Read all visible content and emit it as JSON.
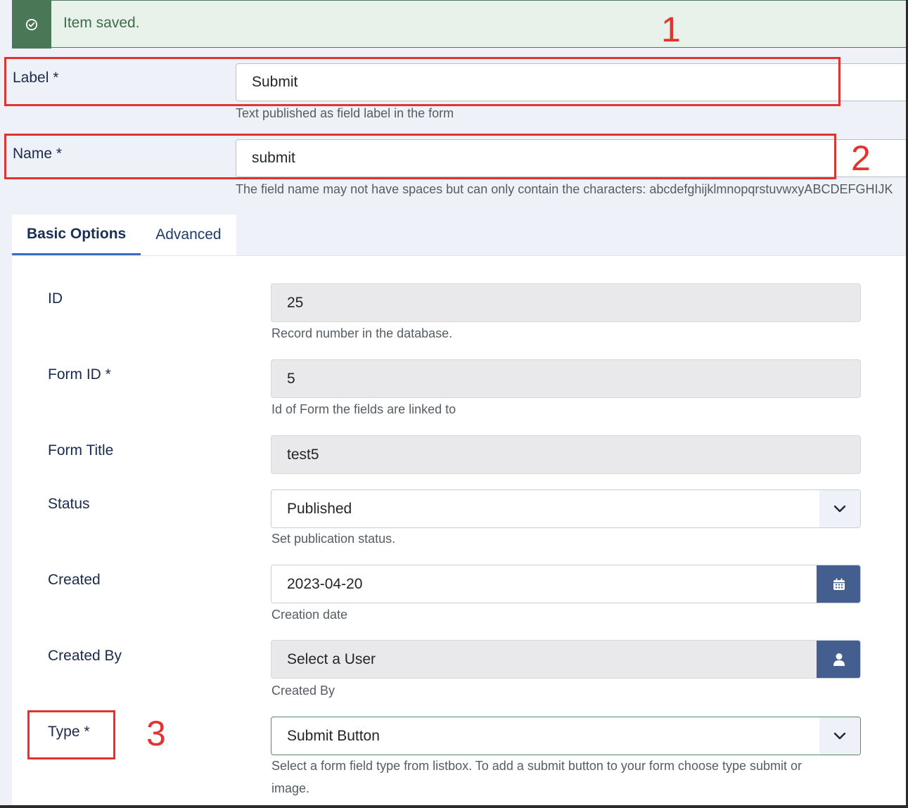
{
  "alert": {
    "message": "Item saved."
  },
  "label_field": {
    "label": "Label *",
    "value": "Submit",
    "hint": "Text published as field label in the form"
  },
  "name_field": {
    "label": "Name *",
    "value": "submit",
    "hint": "The field name may not have spaces but can only contain the characters: abcdefghijklmnopqrstuvwxyABCDEFGHIJK"
  },
  "tabs": [
    {
      "label": "Basic Options"
    },
    {
      "label": "Advanced"
    }
  ],
  "fields": {
    "id": {
      "label": "ID",
      "value": "25",
      "hint": "Record number in the database."
    },
    "form_id": {
      "label": "Form ID *",
      "value": "5",
      "hint": "Id of Form the fields are linked to"
    },
    "form_title": {
      "label": "Form Title",
      "value": "test5"
    },
    "status": {
      "label": "Status",
      "value": "Published",
      "hint": "Set publication status."
    },
    "created": {
      "label": "Created",
      "value": "2023-04-20",
      "hint": "Creation date"
    },
    "created_by": {
      "label": "Created By",
      "value": "Select a User",
      "hint": "Created By"
    },
    "type": {
      "label": "Type *",
      "value": "Submit Button",
      "hint_line1": "Select a form field type from listbox. To add a submit button to your form choose type submit or",
      "hint_line2": "image."
    }
  },
  "annotations": {
    "one": "1",
    "two": "2",
    "three": "3"
  },
  "colors": {
    "annotation": "#e1332f",
    "success": "#4a7857",
    "accent": "#445f8f",
    "tab_underline": "#3a6dc5"
  },
  "icons": {
    "alert": "check-circle-icon",
    "select": "chevron-down-icon",
    "calendar": "calendar-icon",
    "user": "user-icon"
  }
}
